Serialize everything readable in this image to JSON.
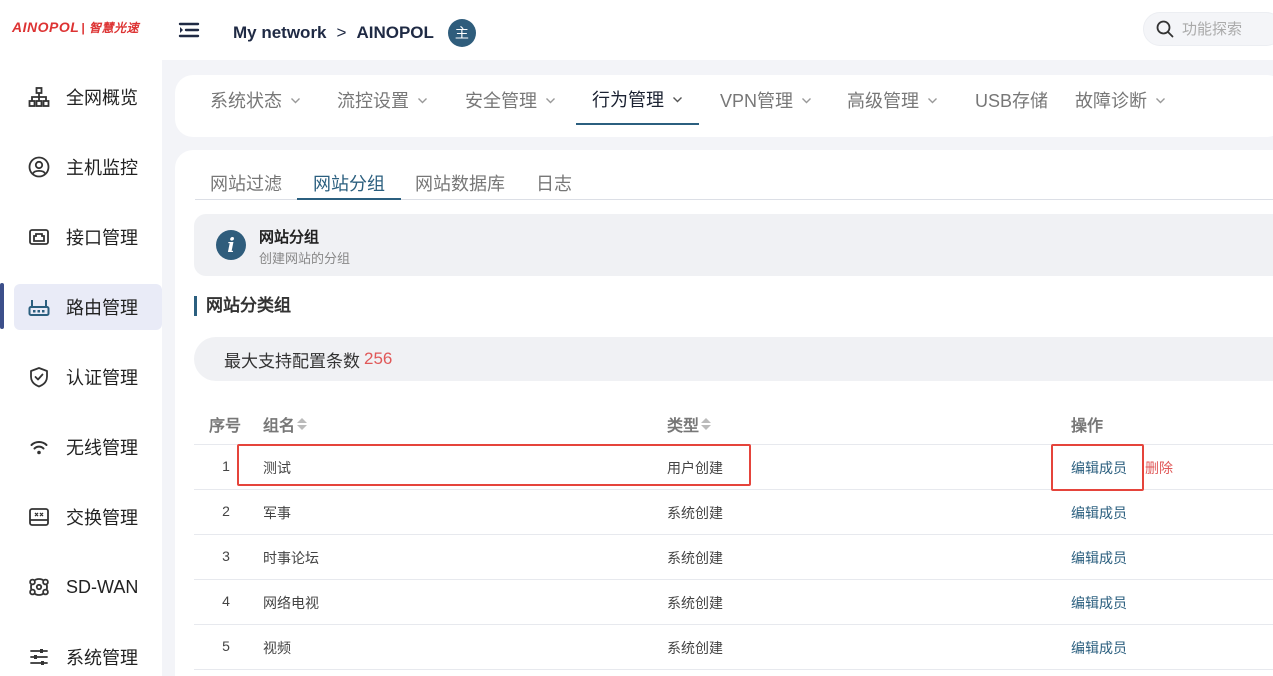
{
  "brand": {
    "logo_text": "AINOPOL",
    "logo_cn": "| 智慧光速"
  },
  "header": {
    "breadcrumb_root": "My network",
    "breadcrumb_sep": ">",
    "breadcrumb_current": "AINOPOL",
    "avatar_text": "主",
    "search_placeholder": "功能探索"
  },
  "sidebar": {
    "items": [
      {
        "label": "全网概览",
        "icon": "topology-icon"
      },
      {
        "label": "主机监控",
        "icon": "user-circle-icon"
      },
      {
        "label": "接口管理",
        "icon": "interface-port-icon"
      },
      {
        "label": "路由管理",
        "icon": "router-icon",
        "active": true
      },
      {
        "label": "认证管理",
        "icon": "shield-check-icon"
      },
      {
        "label": "无线管理",
        "icon": "wifi-icon"
      },
      {
        "label": "交换管理",
        "icon": "switch-icon"
      },
      {
        "label": "SD-WAN",
        "icon": "sdwan-icon"
      },
      {
        "label": "系统管理",
        "icon": "sliders-icon"
      }
    ]
  },
  "mainnav": {
    "items": [
      {
        "label": "系统状态"
      },
      {
        "label": "流控设置"
      },
      {
        "label": "安全管理"
      },
      {
        "label": "行为管理",
        "active": true
      },
      {
        "label": "VPN管理"
      },
      {
        "label": "高级管理"
      },
      {
        "label": "USB存储"
      },
      {
        "label": "故障诊断"
      }
    ]
  },
  "subtabs": {
    "items": [
      {
        "label": "网站过滤"
      },
      {
        "label": "网站分组",
        "active": true
      },
      {
        "label": "网站数据库"
      },
      {
        "label": "日志"
      }
    ]
  },
  "info": {
    "title": "网站分组",
    "subtitle": "创建网站的分组"
  },
  "section": {
    "title": "网站分类组"
  },
  "limit": {
    "label": "最大支持配置条数",
    "value": "256"
  },
  "table": {
    "headers": {
      "index": "序号",
      "name": "组名",
      "type": "类型",
      "action": "操作"
    },
    "rows": [
      {
        "index": "1",
        "name": "测试",
        "type": "用户创建",
        "edit": "编辑成员",
        "delete": "删除"
      },
      {
        "index": "2",
        "name": "军事",
        "type": "系统创建",
        "edit": "编辑成员"
      },
      {
        "index": "3",
        "name": "时事论坛",
        "type": "系统创建",
        "edit": "编辑成员"
      },
      {
        "index": "4",
        "name": "网络电视",
        "type": "系统创建",
        "edit": "编辑成员"
      },
      {
        "index": "5",
        "name": "视频",
        "type": "系统创建",
        "edit": "编辑成员"
      }
    ]
  },
  "colors": {
    "accent": "#2b5f7f",
    "danger": "#e05858",
    "highlight_box": "#e5443b"
  }
}
